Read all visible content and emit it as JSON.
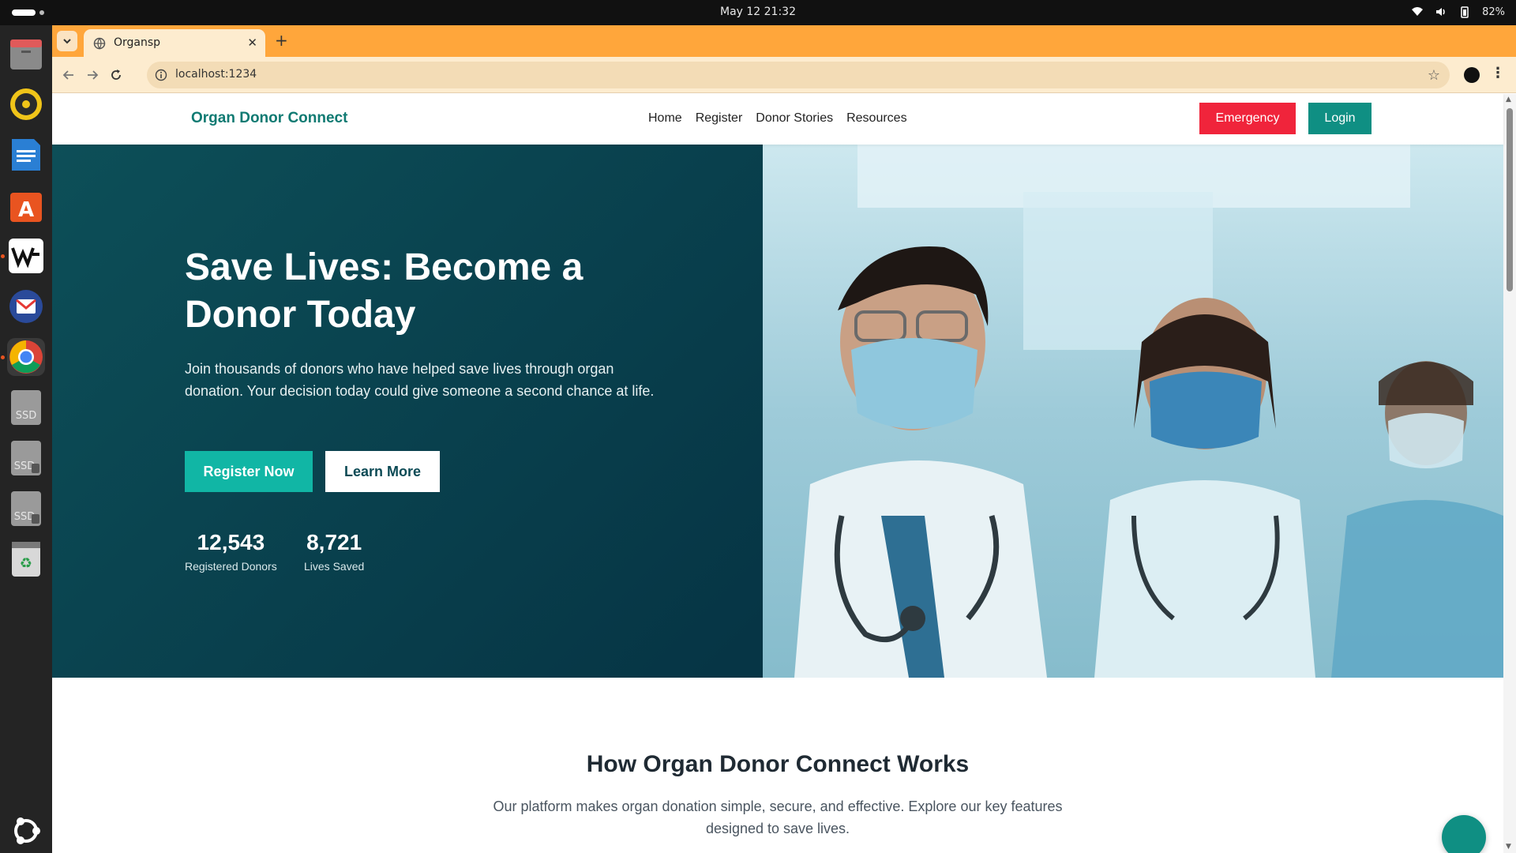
{
  "system_bar": {
    "datetime": "May 12  21:32",
    "battery": "82%"
  },
  "dock": {
    "items": [
      "files-icon",
      "rhythmbox-icon",
      "writer-icon",
      "app-center-icon",
      "wps-icon",
      "mail-icon",
      "chrome-icon",
      "ssd-drive-icon",
      "ssd-drive-icon-2",
      "ssd-drive-icon-3",
      "trash-icon",
      "ubuntu-icon"
    ],
    "ssd_label": "SSD"
  },
  "browser": {
    "tab_title": "Organsp",
    "url": "localhost:1234",
    "accent_color": "#ffa63b"
  },
  "site": {
    "brand": "Organ Donor Connect",
    "nav": [
      {
        "label": "Home"
      },
      {
        "label": "Register"
      },
      {
        "label": "Donor Stories"
      },
      {
        "label": "Resources"
      }
    ],
    "emergency_label": "Emergency",
    "login_label": "Login",
    "hero": {
      "title": "Save Lives: Become a Donor Today",
      "subtitle": "Join thousands of donors who have helped save lives through organ donation. Your decision today could give someone a second chance at life.",
      "register_label": "Register Now",
      "learn_label": "Learn More",
      "stats": [
        {
          "number": "12,543",
          "label": "Registered Donors"
        },
        {
          "number": "8,721",
          "label": "Lives Saved"
        }
      ]
    },
    "how_it_works": {
      "title": "How Organ Donor Connect Works",
      "subtitle": "Our platform makes organ donation simple, secure, and effective. Explore our key features designed to save lives."
    },
    "colors": {
      "brand": "#0f7a72",
      "emergency": "#f0243b",
      "primary": "#11b6a5",
      "hero_bg": "#063545"
    }
  }
}
